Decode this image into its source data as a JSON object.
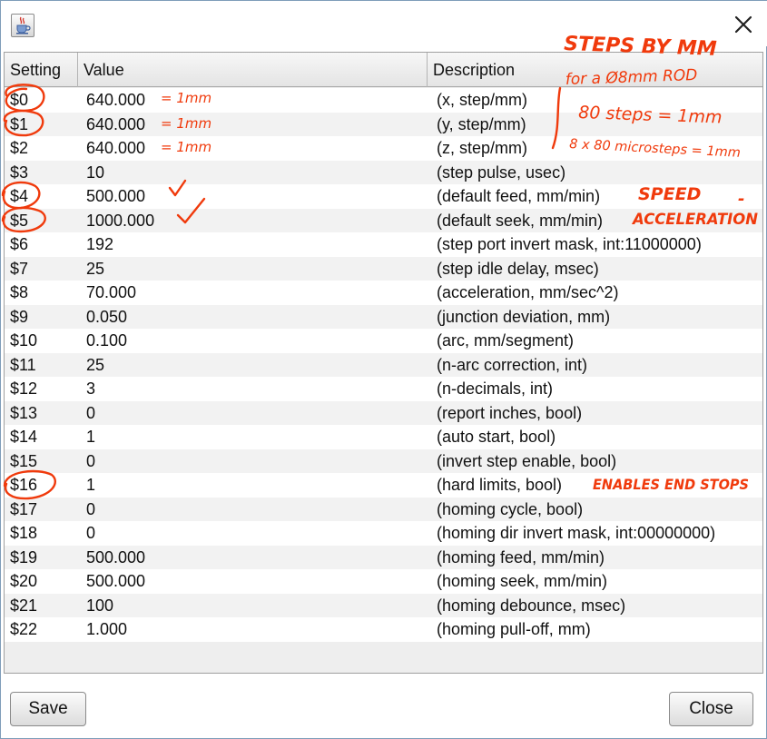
{
  "icons": {
    "app": "java-cup-icon",
    "close": "close-icon"
  },
  "table": {
    "headers": [
      "Setting",
      "Value",
      "Description"
    ],
    "rows": [
      {
        "setting": "$0",
        "value": "640.000",
        "description": "(x, step/mm)"
      },
      {
        "setting": "$1",
        "value": "640.000",
        "description": "(y, step/mm)"
      },
      {
        "setting": "$2",
        "value": "640.000",
        "description": "(z, step/mm)"
      },
      {
        "setting": "$3",
        "value": "10",
        "description": "(step pulse, usec)"
      },
      {
        "setting": "$4",
        "value": "500.000",
        "description": "(default feed, mm/min)"
      },
      {
        "setting": "$5",
        "value": "1000.000",
        "description": "(default seek, mm/min)"
      },
      {
        "setting": "$6",
        "value": "192",
        "description": "(step port invert mask, int:11000000)"
      },
      {
        "setting": "$7",
        "value": "25",
        "description": "(step idle delay, msec)"
      },
      {
        "setting": "$8",
        "value": "70.000",
        "description": "(acceleration, mm/sec^2)"
      },
      {
        "setting": "$9",
        "value": "0.050",
        "description": "(junction deviation, mm)"
      },
      {
        "setting": "$10",
        "value": "0.100",
        "description": "(arc, mm/segment)"
      },
      {
        "setting": "$11",
        "value": "25",
        "description": "(n-arc correction, int)"
      },
      {
        "setting": "$12",
        "value": "3",
        "description": "(n-decimals, int)"
      },
      {
        "setting": "$13",
        "value": "0",
        "description": "(report inches, bool)"
      },
      {
        "setting": "$14",
        "value": "1",
        "description": "(auto start, bool)"
      },
      {
        "setting": "$15",
        "value": "0",
        "description": "(invert step enable, bool)"
      },
      {
        "setting": "$16",
        "value": "1",
        "description": "(hard limits, bool)"
      },
      {
        "setting": "$17",
        "value": "0",
        "description": "(homing cycle, bool)"
      },
      {
        "setting": "$18",
        "value": "0",
        "description": "(homing dir invert mask, int:00000000)"
      },
      {
        "setting": "$19",
        "value": "500.000",
        "description": "(homing feed, mm/min)"
      },
      {
        "setting": "$20",
        "value": "500.000",
        "description": "(homing seek, mm/min)"
      },
      {
        "setting": "$21",
        "value": "100",
        "description": "(homing debounce, msec)"
      },
      {
        "setting": "$22",
        "value": "1.000",
        "description": "(homing pull-off, mm)"
      }
    ]
  },
  "annotations": {
    "color": "#f03a0c",
    "steps_title": "STEPS BY MM",
    "rod_note": "for a Ø8mm ROD",
    "steps_note": "80 steps = 1mm",
    "micro_note": "8 x 80 microsteps = 1mm",
    "row0_note": "= 1mm",
    "row1_note": "= 1mm",
    "row2_note": "= 1mm",
    "speed_note": "SPEED",
    "dash_note": "-",
    "accel_note": "ACCELERATION",
    "endstops_note": "ENABLES END STOPS"
  },
  "buttons": {
    "save": "Save",
    "close": "Close"
  }
}
